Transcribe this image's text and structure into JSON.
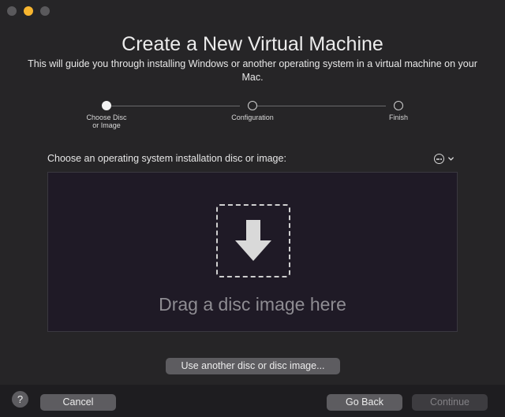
{
  "window": {
    "title": "Create a New Virtual Machine",
    "subtitle": "This will guide you through installing Windows or another operating system in a virtual machine on your Mac."
  },
  "steps": [
    {
      "label": "Choose Disc\nor Image",
      "state": "active"
    },
    {
      "label": "Configuration",
      "state": "pending"
    },
    {
      "label": "Finish",
      "state": "pending"
    }
  ],
  "choose": {
    "label": "Choose an operating system installation disc or image:",
    "more_icon": "ellipsis-circle-icon",
    "chevron_icon": "chevron-down-icon"
  },
  "drop_zone": {
    "text": "Drag a disc image here",
    "icon": "arrow-down-icon"
  },
  "buttons": {
    "use_another": "Use another disc or disc image...",
    "help": "?",
    "cancel": "Cancel",
    "go_back": "Go Back",
    "continue": "Continue"
  },
  "colors": {
    "window_bg": "#262527",
    "drop_zone_bg": "#1f1a26",
    "button_bg": "#5d5c60",
    "minimize_dot": "#f7b52f"
  }
}
